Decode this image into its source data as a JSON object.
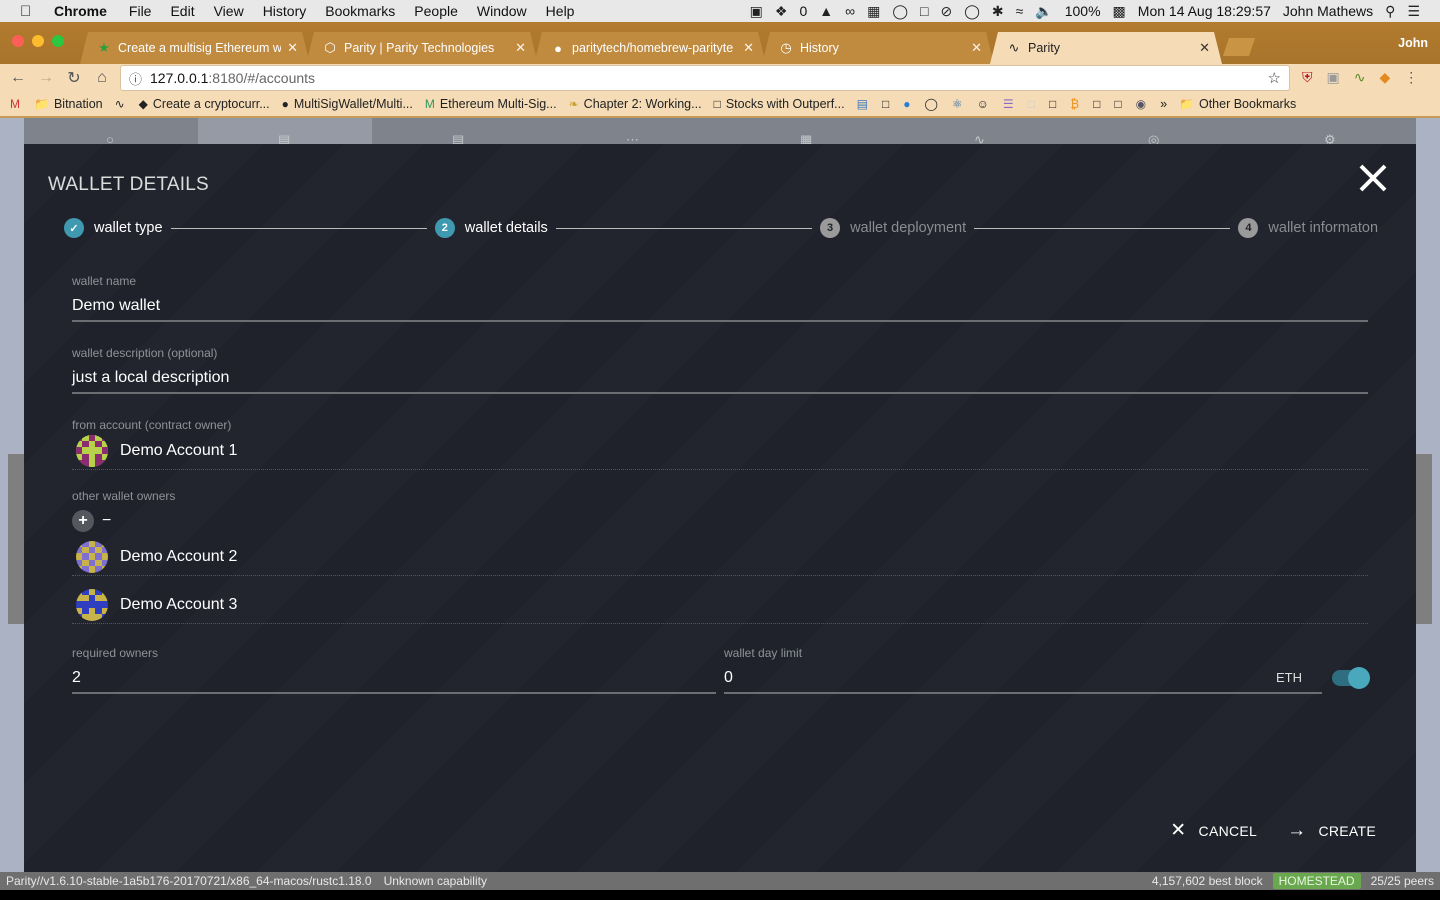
{
  "menubar": {
    "app_name": "Chrome",
    "items": [
      "File",
      "Edit",
      "View",
      "History",
      "Bookmarks",
      "People",
      "Window",
      "Help"
    ],
    "tray_count": "0",
    "battery": "100%",
    "datetime": "Mon 14 Aug  18:29:57",
    "user": "John Mathews"
  },
  "browser": {
    "tabs": [
      {
        "title": "Create a multisig Ethereum wa",
        "icon": "star-icon",
        "active": false
      },
      {
        "title": "Parity | Parity Technologies",
        "icon": "parity-hex-icon",
        "active": false
      },
      {
        "title": "paritytech/homebrew-parityte",
        "icon": "github-icon",
        "active": false
      },
      {
        "title": "History",
        "icon": "history-icon",
        "active": false
      },
      {
        "title": "Parity",
        "icon": "parity-icon",
        "active": true
      }
    ],
    "profile": "John",
    "url_host": "127.0.0.1",
    "url_path": ":8180/#/accounts",
    "bookmarks": [
      "Bitnation",
      "Create a cryptocurr...",
      "MultiSigWallet/Multi...",
      "Ethereum Multi-Sig...",
      "Chapter 2: Working...",
      "Stocks with Outperf..."
    ],
    "bookmarks_more": "»",
    "other_bookmarks": "Other Bookmarks"
  },
  "modal": {
    "title": "WALLET DETAILS",
    "steps": [
      {
        "number": "1",
        "label": "wallet type",
        "state": "done"
      },
      {
        "number": "2",
        "label": "wallet details",
        "state": "active"
      },
      {
        "number": "3",
        "label": "wallet deployment",
        "state": "pending"
      },
      {
        "number": "4",
        "label": "wallet informaton",
        "state": "pending"
      }
    ],
    "wallet_name": {
      "label": "wallet name",
      "value": "Demo wallet"
    },
    "wallet_description": {
      "label": "wallet description (optional)",
      "value": "just a local description"
    },
    "from_account": {
      "label": "from account (contract owner)",
      "name": "Demo Account 1"
    },
    "other_owners": {
      "label": "other wallet owners",
      "add_label": "+",
      "remove_label": "−",
      "owners": [
        {
          "name": "Demo Account 2"
        },
        {
          "name": "Demo Account 3"
        }
      ]
    },
    "required_owners": {
      "label": "required owners",
      "value": "2"
    },
    "day_limit": {
      "label": "wallet day limit",
      "value": "0",
      "unit": "ETH",
      "toggle_on": true
    },
    "actions": {
      "cancel": "CANCEL",
      "create": "CREATE"
    }
  },
  "statusbar": {
    "version": "Parity//v1.6.10-stable-1a5b176-20170721/x86_64-macos/rustc1.18.0",
    "capability": "Unknown capability",
    "best_block": "4,157,602 best block",
    "chain": "HOMESTEAD",
    "peers": "25/25 peers"
  },
  "colors": {
    "accent": "#3f9ab1",
    "modal_bg": "#1f222a",
    "chain_badge": "#6aa84f"
  }
}
